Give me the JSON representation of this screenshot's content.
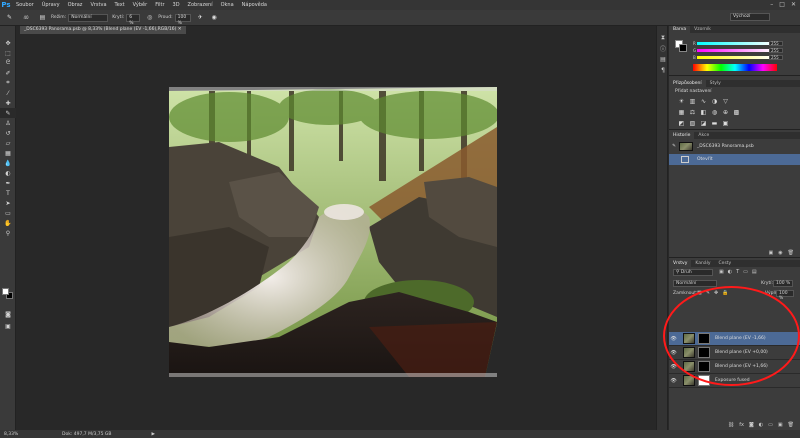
{
  "app": {
    "logo": "Ps"
  },
  "menu": [
    "Soubor",
    "Úpravy",
    "Obraz",
    "Vrstva",
    "Text",
    "Výběr",
    "Filtr",
    "3D",
    "Zobrazení",
    "Okna",
    "Nápověda"
  ],
  "window_controls": [
    "–",
    "□",
    "✕"
  ],
  "options_bar": {
    "brush_size": "40",
    "mode_label": "Režim:",
    "mode_value": "Normální",
    "opacity_label": "Krytí:",
    "opacity_value": "6 %",
    "flow_label": "Proud:",
    "flow_value": "100 %",
    "workspace_value": "Výchozí"
  },
  "document_tab": "_DSC6393 Panorama.psb @ 8,33% (Blend plane (EV -1,66),RGB/16) ✕",
  "status_bar": {
    "zoom": "8,33%",
    "doc_info": "Dok: 497,7 M/3,75 GB"
  },
  "color_panel": {
    "tabs": [
      "Barva",
      "Vzorník"
    ],
    "values": [
      "255",
      "255",
      "255"
    ],
    "channel_labels": [
      "R",
      "G",
      "B"
    ]
  },
  "adjustments_panel": {
    "tabs": [
      "Přizpůsobení",
      "Styly"
    ],
    "title": "Přidat nastavení"
  },
  "history_panel": {
    "tabs": [
      "Historie",
      "Akce"
    ],
    "items": [
      {
        "label": "_DSC6393 Panorama.psb",
        "selected": false
      },
      {
        "label": "Otevřít",
        "selected": true
      }
    ]
  },
  "layers_panel": {
    "tabs": [
      "Vrstvy",
      "Kanály",
      "Cesty"
    ],
    "kind_filter": "Druh",
    "blend_mode": "Normální",
    "opacity_label": "Krytí:",
    "opacity_value": "100 %",
    "fill_label": "Výplň:",
    "fill_value": "100 %",
    "lock_label": "Zamknout:",
    "layers": [
      {
        "name": "Blend plane (EV -1,66)",
        "mask": "black",
        "selected": true
      },
      {
        "name": "Blend plane (EV +0,00)",
        "mask": "black",
        "selected": false
      },
      {
        "name": "Blend plane (EV +1,66)",
        "mask": "black",
        "selected": false
      },
      {
        "name": "Exposure fused",
        "mask": "white",
        "selected": false
      }
    ]
  },
  "annotation_color": "#ff1a1a"
}
